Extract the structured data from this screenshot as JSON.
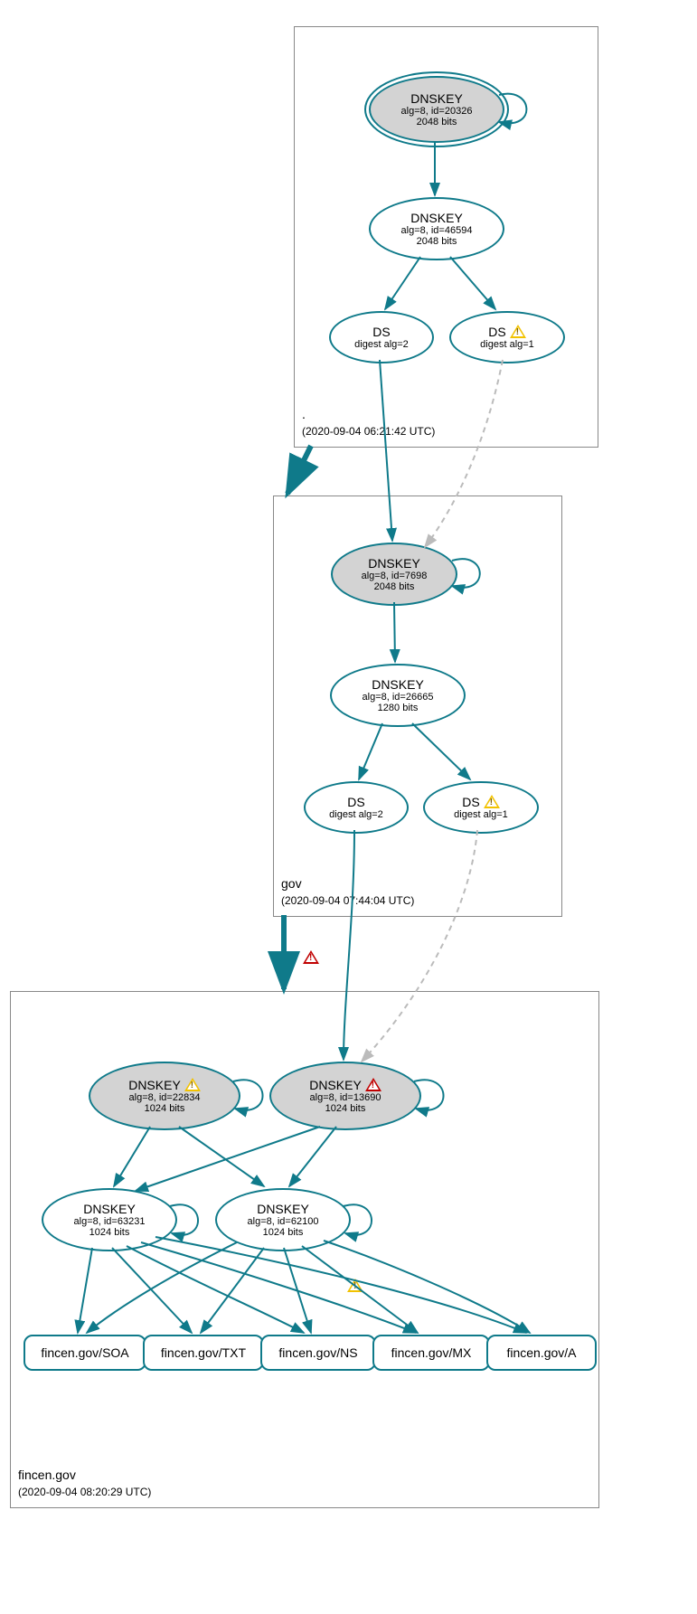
{
  "zones": {
    "root": {
      "label": ".",
      "timestamp": "(2020-09-04 06:21:42 UTC)"
    },
    "gov": {
      "label": "gov",
      "timestamp": "(2020-09-04 07:44:04 UTC)"
    },
    "fincen": {
      "label": "fincen.gov",
      "timestamp": "(2020-09-04 08:20:29 UTC)"
    }
  },
  "nodes": {
    "root_ksk": {
      "title": "DNSKEY",
      "line1": "alg=8, id=20326",
      "line2": "2048 bits"
    },
    "root_zsk": {
      "title": "DNSKEY",
      "line1": "alg=8, id=46594",
      "line2": "2048 bits"
    },
    "root_ds2": {
      "title": "DS",
      "line1": "digest alg=2"
    },
    "root_ds1": {
      "title": "DS",
      "line1": "digest alg=1"
    },
    "gov_ksk": {
      "title": "DNSKEY",
      "line1": "alg=8, id=7698",
      "line2": "2048 bits"
    },
    "gov_zsk": {
      "title": "DNSKEY",
      "line1": "alg=8, id=26665",
      "line2": "1280 bits"
    },
    "gov_ds2": {
      "title": "DS",
      "line1": "digest alg=2"
    },
    "gov_ds1": {
      "title": "DS",
      "line1": "digest alg=1"
    },
    "fin_k22834": {
      "title": "DNSKEY",
      "line1": "alg=8, id=22834",
      "line2": "1024 bits"
    },
    "fin_k13690": {
      "title": "DNSKEY",
      "line1": "alg=8, id=13690",
      "line2": "1024 bits"
    },
    "fin_k63231": {
      "title": "DNSKEY",
      "line1": "alg=8, id=63231",
      "line2": "1024 bits"
    },
    "fin_k62100": {
      "title": "DNSKEY",
      "line1": "alg=8, id=62100",
      "line2": "1024 bits"
    },
    "rr_soa": "fincen.gov/SOA",
    "rr_txt": "fincen.gov/TXT",
    "rr_ns": "fincen.gov/NS",
    "rr_mx": "fincen.gov/MX",
    "rr_a": "fincen.gov/A"
  },
  "colors": {
    "stroke": "#0f7a8a",
    "fill_grey": "#d3d3d3",
    "warn": "#f2c200",
    "error": "#c00000"
  }
}
